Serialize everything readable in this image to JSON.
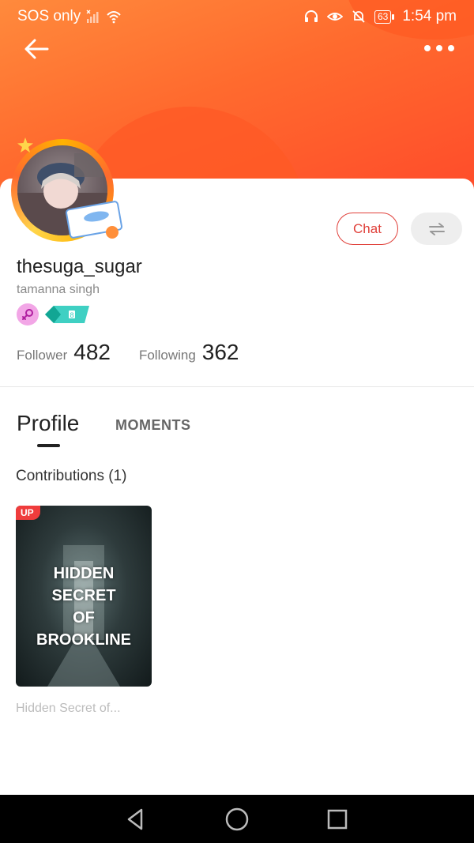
{
  "status_bar": {
    "carrier": "SOS only",
    "battery": "63",
    "time": "1:54 pm"
  },
  "header": {
    "back_icon": "arrow-left-icon",
    "more_icon": "more-horizontal-icon"
  },
  "actions": {
    "chat_label": "Chat",
    "switch_icon": "swap-icon"
  },
  "profile": {
    "username": "thesuga_sugar",
    "real_name": "tamanna singh",
    "badges": [
      "female-icon",
      "level-badge-icon"
    ],
    "level_badge_text": "8"
  },
  "stats": {
    "follower_label": "Follower",
    "follower_value": "482",
    "following_label": "Following",
    "following_value": "362"
  },
  "tabs": [
    {
      "label": "Profile",
      "active": true
    },
    {
      "label": "MOMENTS",
      "active": false
    }
  ],
  "contributions": {
    "title": "Contributions (1)",
    "items": [
      {
        "badge": "UP",
        "cover_title": "HIDDEN\nSECRET\nOF\nBROOKLINE",
        "name": "Hidden Secret of..."
      }
    ]
  },
  "colors": {
    "accent": "#e0403a",
    "header_start": "#ff8a3c",
    "header_end": "#ff4a2a"
  }
}
